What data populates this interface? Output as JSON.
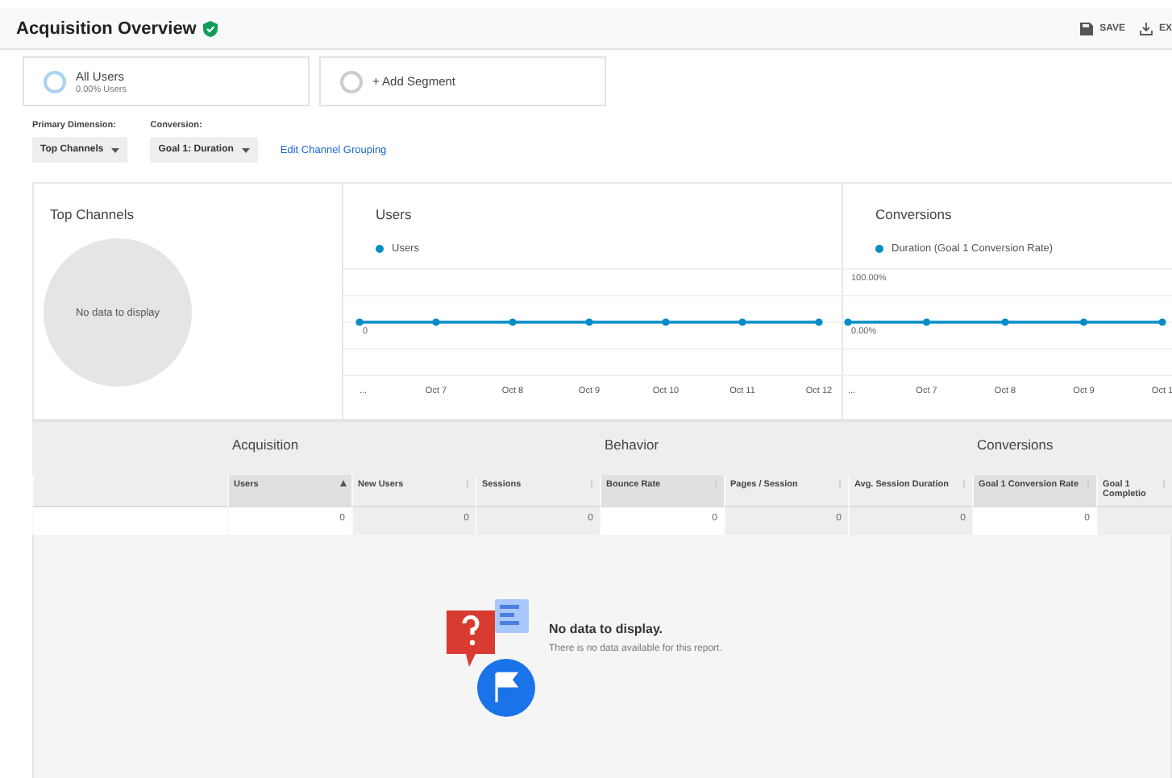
{
  "header": {
    "title": "Acquisition Overview",
    "verified": true,
    "actions": [
      {
        "kind": "save",
        "label": "SAVE"
      },
      {
        "kind": "export",
        "label": "EX"
      }
    ]
  },
  "segments": [
    {
      "name": "All Users",
      "detail": "0.00% Users",
      "active": true
    },
    {
      "name": "+ Add Segment",
      "active": false
    }
  ],
  "controls": {
    "primary_dimension": {
      "label": "Primary Dimension:",
      "value": "Top Channels"
    },
    "conversion": {
      "label": "Conversion:",
      "value": "Goal 1: Duration"
    },
    "link": "Edit Channel Grouping"
  },
  "panels": {
    "top_channels": {
      "title": "Top Channels",
      "empty_text": "No data to display"
    },
    "users_chart": {
      "title": "Users",
      "legend": "Users",
      "y_labels": [
        "0"
      ],
      "x_labels": [
        "...",
        "Oct 7",
        "Oct 8",
        "Oct 9",
        "Oct 10",
        "Oct 11",
        "Oct 12"
      ]
    },
    "conversions_chart": {
      "title": "Conversions",
      "legend": "Duration (Goal 1 Conversion Rate)",
      "y_labels": [
        "100.00%",
        "0.00%"
      ],
      "x_labels": [
        "...",
        "Oct 7",
        "Oct 8",
        "Oct 9",
        "Oct 1"
      ]
    }
  },
  "table": {
    "groups": [
      {
        "label": "Acquisition",
        "columns": [
          {
            "label": "Users",
            "highlighted": true,
            "sorted": true
          },
          {
            "label": "New Users",
            "highlighted": false,
            "sorted": false
          },
          {
            "label": "Sessions",
            "highlighted": false,
            "sorted": false
          }
        ]
      },
      {
        "label": "Behavior",
        "columns": [
          {
            "label": "Bounce Rate",
            "highlighted": true,
            "sorted": false
          },
          {
            "label": "Pages / Session",
            "highlighted": false,
            "sorted": false
          },
          {
            "label": "Avg. Session Duration",
            "highlighted": false,
            "sorted": false
          }
        ]
      },
      {
        "label": "Conversions",
        "columns": [
          {
            "label": "Goal 1 Conversion Rate",
            "highlighted": true,
            "sorted": false
          },
          {
            "label": "Goal 1 Completio",
            "highlighted": false,
            "sorted": false
          }
        ]
      }
    ],
    "rows": [
      {
        "values": [
          "0",
          "0",
          "0",
          "0",
          "0",
          "0",
          "0"
        ]
      }
    ]
  },
  "empty_state": {
    "title": "No data to display.",
    "message": "There is no data available for this report."
  }
}
